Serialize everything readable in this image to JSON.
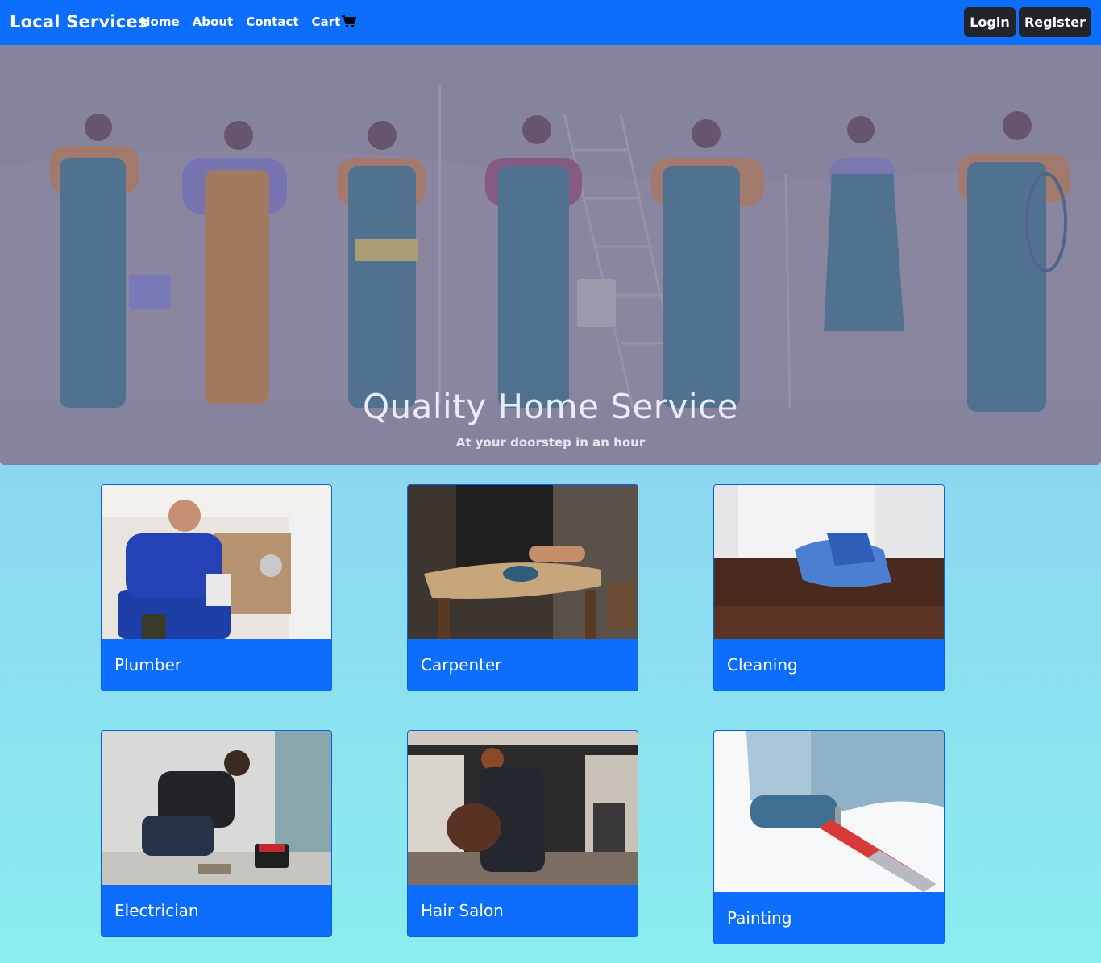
{
  "nav": {
    "brand": "Local Services",
    "links": [
      "Home",
      "About",
      "Contact",
      "Cart"
    ],
    "login": "Login",
    "register": "Register"
  },
  "hero": {
    "title": "Quality Home Service",
    "subtitle": "At your doorstep in an hour"
  },
  "services": [
    {
      "label": "Plumber"
    },
    {
      "label": "Carpenter"
    },
    {
      "label": "Cleaning"
    },
    {
      "label": "Electrician"
    },
    {
      "label": "Hair Salon"
    },
    {
      "label": "Painting"
    }
  ],
  "colors": {
    "primary": "#0d6efd",
    "dark": "#212529"
  }
}
